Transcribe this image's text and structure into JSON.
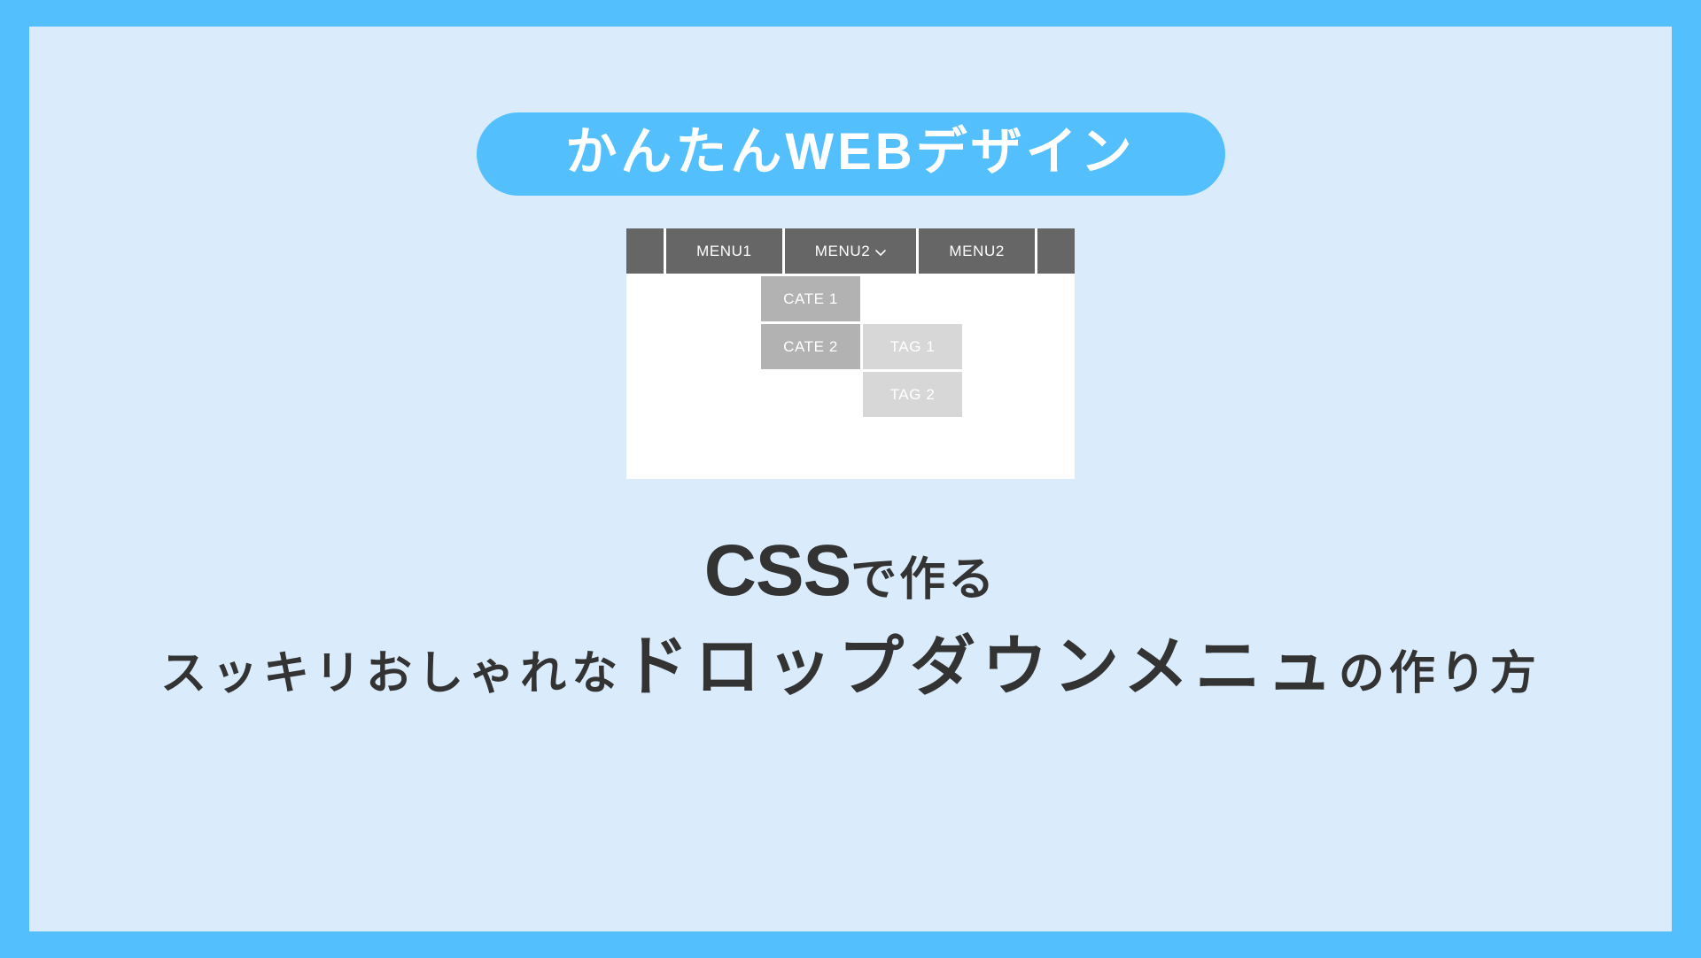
{
  "poster": {
    "frame_color": "#54bffd",
    "panel_color": "#daecfb"
  },
  "title_badge": {
    "label": "かんたんWEBデザイン",
    "background": "#54bffd",
    "text_color": "#ffffff"
  },
  "mockup": {
    "card_background": "#ffffff",
    "navbar": {
      "background": "#666666",
      "text_color": "#ffffff",
      "cells": [
        {
          "label": "",
          "type": "edge"
        },
        {
          "label": "MENU1",
          "type": "wide"
        },
        {
          "label": "MENU2",
          "type": "wide",
          "icon": "chevron-down-icon",
          "expanded": true
        },
        {
          "label": "MENU2",
          "type": "wide"
        },
        {
          "label": "",
          "type": "edge"
        }
      ]
    },
    "dropdown": {
      "category_color": "#b2b2b2",
      "tag_color": "#d7d7d7",
      "categories": [
        {
          "label": "CATE 1"
        },
        {
          "label": "CATE 2"
        }
      ],
      "tags": [
        {
          "label": "TAG 1"
        },
        {
          "label": "TAG 2"
        }
      ]
    }
  },
  "headline": {
    "line1_big": "CSS",
    "line1_small": "で作る",
    "line2_lead": "スッキリおしゃれな",
    "line2_emph": "ドロップダウンメニュ",
    "line2_tail": "の作り方",
    "text_color": "#333333"
  }
}
